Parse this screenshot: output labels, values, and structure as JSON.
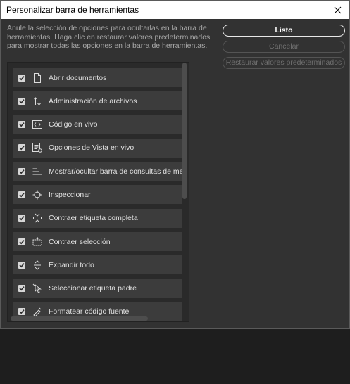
{
  "window": {
    "title": "Personalizar barra de herramientas"
  },
  "description": "Anule la selección de opciones para ocultarlas en la barra de herramientas. Haga clic en restaurar valores predeterminados para mostrar todas las opciones en la barra de herramientas.",
  "buttons": {
    "done": "Listo",
    "cancel": "Cancelar",
    "restore": "Restaurar valores predeterminados"
  },
  "items": [
    {
      "label": "Abrir documentos",
      "icon": "document-icon",
      "checked": true
    },
    {
      "label": "Administración de archivos",
      "icon": "file-transfer-icon",
      "checked": true
    },
    {
      "label": "Código en vivo",
      "icon": "live-code-icon",
      "checked": true
    },
    {
      "label": "Opciones de Vista en vivo",
      "icon": "live-view-options-icon",
      "checked": true
    },
    {
      "label": "Mostrar/ocultar barra de consultas de medios v",
      "icon": "media-query-bar-icon",
      "checked": true
    },
    {
      "label": "Inspeccionar",
      "icon": "inspect-icon",
      "checked": true
    },
    {
      "label": "Contraer etiqueta completa",
      "icon": "collapse-full-tag-icon",
      "checked": true
    },
    {
      "label": "Contraer selección",
      "icon": "collapse-selection-icon",
      "checked": true
    },
    {
      "label": "Expandir todo",
      "icon": "expand-all-icon",
      "checked": true
    },
    {
      "label": "Seleccionar etiqueta padre",
      "icon": "select-parent-tag-icon",
      "checked": true
    },
    {
      "label": "Formatear código fuente",
      "icon": "format-source-icon",
      "checked": true
    }
  ]
}
